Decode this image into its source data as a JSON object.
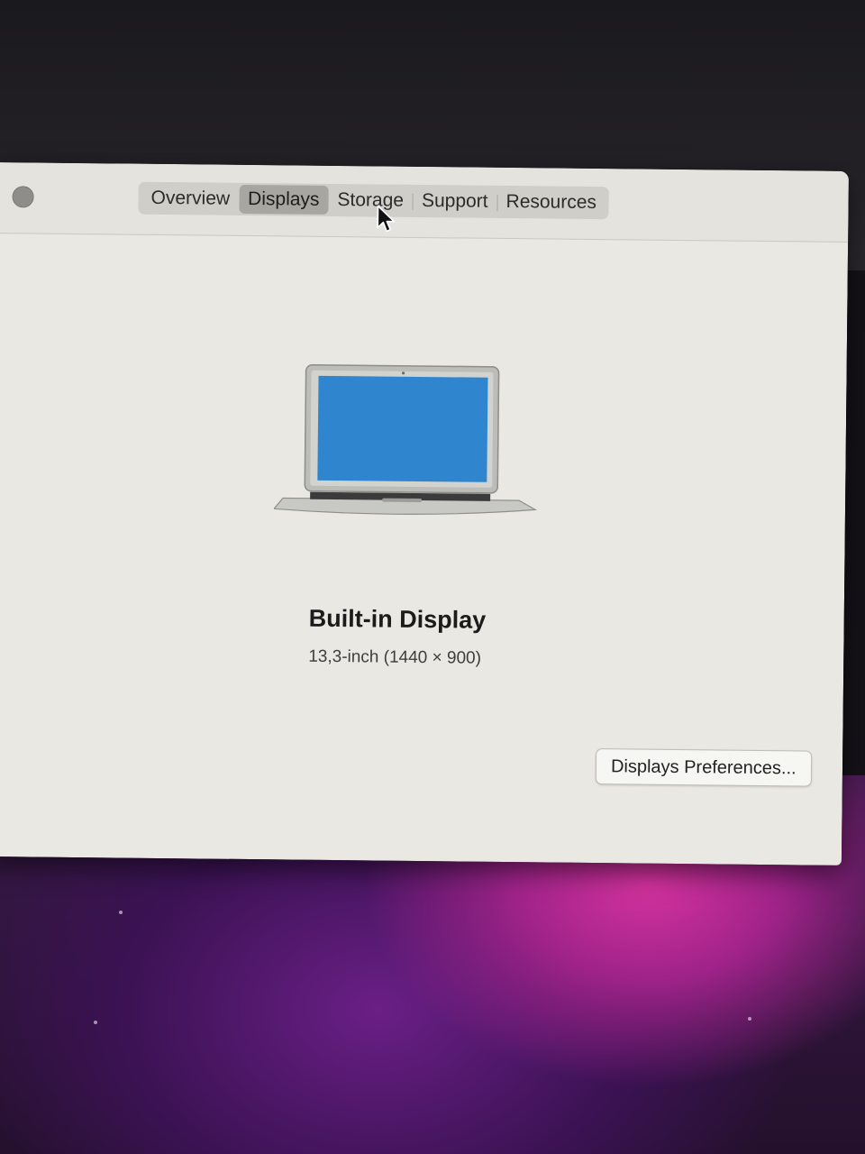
{
  "window": {
    "tabs": [
      {
        "label": "Overview",
        "selected": false
      },
      {
        "label": "Displays",
        "selected": true
      },
      {
        "label": "Storage",
        "selected": false
      },
      {
        "label": "Support",
        "selected": false
      },
      {
        "label": "Resources",
        "selected": false
      }
    ]
  },
  "display": {
    "name": "Built-in Display",
    "spec": "13,3-inch (1440 × 900)",
    "icon": "macbook-air-icon",
    "screen_color": "#2f86cf"
  },
  "actions": {
    "preferences_label": "Displays Preferences..."
  },
  "colors": {
    "window_background": "#e9e8e3",
    "selected_tab": "#a8a6a1",
    "wallpaper_accent": "#d5329e"
  }
}
